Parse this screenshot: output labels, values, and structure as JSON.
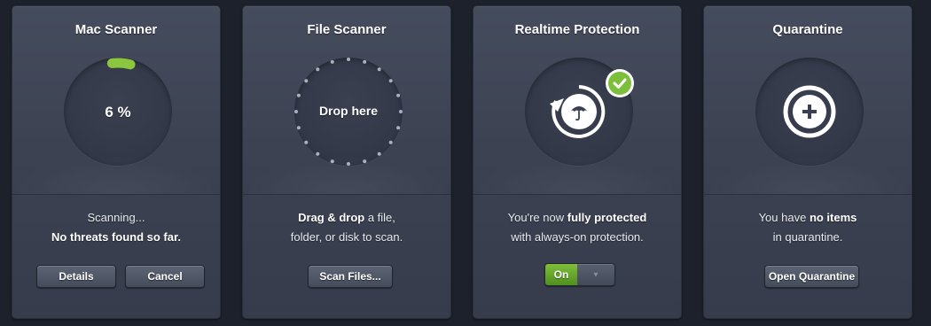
{
  "mac_scanner": {
    "title": "Mac Scanner",
    "progress_text": "6 %",
    "progress": 0.06,
    "status_line1": "Scanning...",
    "status_line2": "No threats found so far.",
    "details_label": "Details",
    "cancel_label": "Cancel"
  },
  "file_scanner": {
    "title": "File Scanner",
    "drop_label": "Drop here",
    "desc_bold": "Drag & drop",
    "desc_rest1": " a file,",
    "desc_line2": "folder, or disk to scan.",
    "scan_label": "Scan Files..."
  },
  "realtime": {
    "title": "Realtime Protection",
    "desc_pre": "You're now ",
    "desc_bold": "fully protected",
    "desc_line2": "with always-on protection.",
    "toggle_label": "On",
    "icon": "umbrella-refresh-icon",
    "status_icon": "check-icon"
  },
  "quarantine": {
    "title": "Quarantine",
    "desc_pre": "You have ",
    "desc_bold": "no items",
    "desc_line2": "in quarantine.",
    "open_label": "Open Quarantine",
    "icon": "plus-icon"
  },
  "colors": {
    "accent_green": "#8cc63f",
    "panel": "#3f4555",
    "background": "#1c212b"
  }
}
